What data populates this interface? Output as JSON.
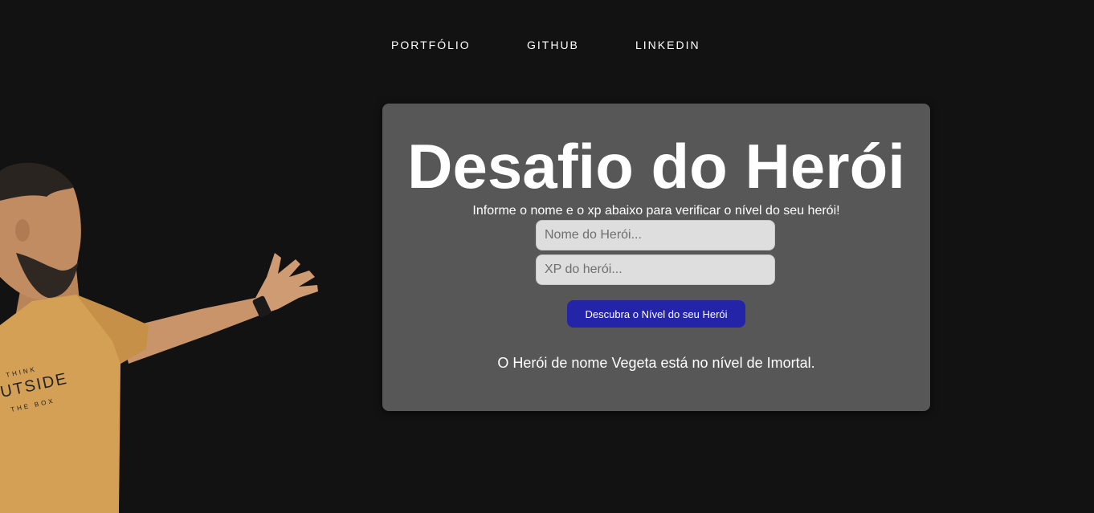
{
  "nav": {
    "items": [
      {
        "label": "PORTFÓLIO"
      },
      {
        "label": "GITHUB"
      },
      {
        "label": "LINKEDIN"
      }
    ]
  },
  "hero_image": {
    "shirt_text_top": "THINK",
    "shirt_text_main": "UTSIDE",
    "shirt_text_bottom": "THE BOX"
  },
  "card": {
    "title": "Desafio do Herói",
    "subtitle": "Informe o nome e o xp abaixo para verificar o nível do seu herói!",
    "name_input": {
      "value": "",
      "placeholder": "Nome do Herói..."
    },
    "xp_input": {
      "value": "",
      "placeholder": "XP do herói..."
    },
    "button_label": "Descubra o Nível do seu Herói",
    "result": "O Herói de nome Vegeta está no nível de Imortal."
  },
  "colors": {
    "background": "#121212",
    "card": "#575757",
    "button": "#2324a8",
    "input": "#dedede",
    "shirt": "#d4a055"
  }
}
